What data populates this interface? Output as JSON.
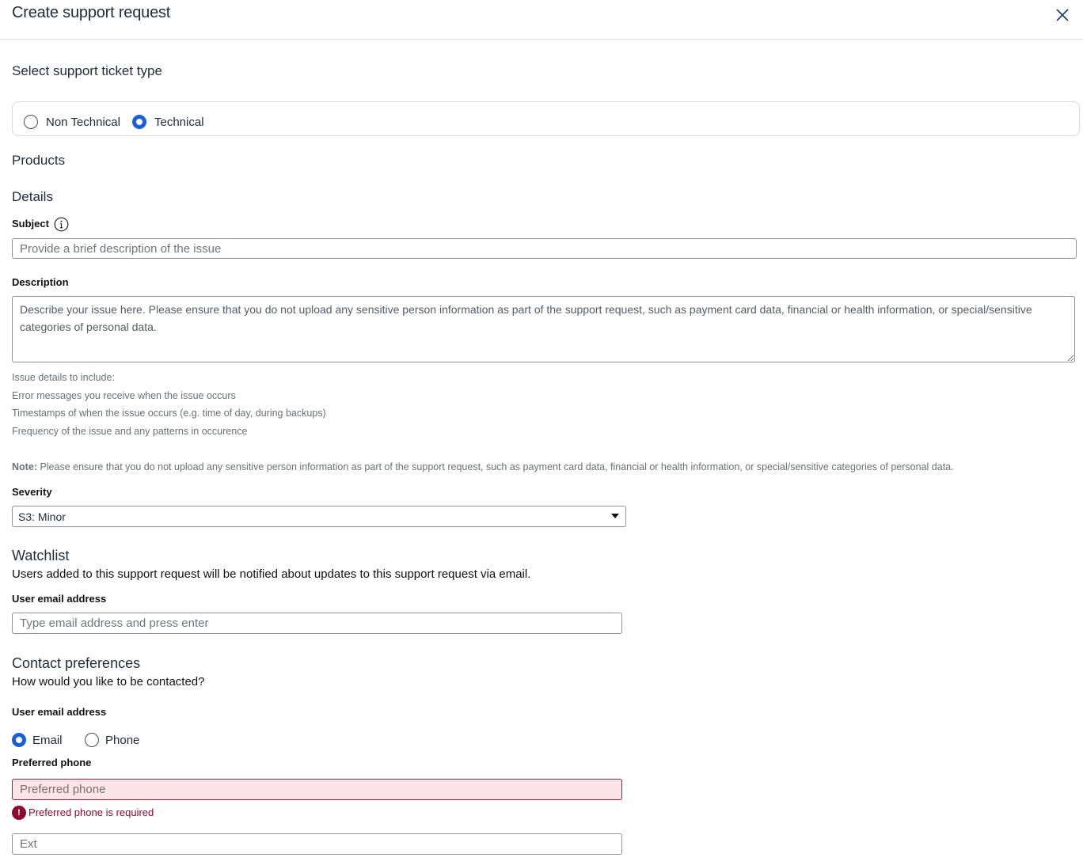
{
  "header": {
    "title": "Create support request"
  },
  "ticket_type": {
    "title": "Select support ticket type",
    "options": [
      {
        "label": "Non Technical",
        "selected": false
      },
      {
        "label": "Technical",
        "selected": true
      }
    ]
  },
  "products": {
    "title": "Products"
  },
  "details": {
    "title": "Details",
    "subject": {
      "label": "Subject",
      "placeholder": "Provide a brief description of the issue",
      "value": ""
    },
    "description": {
      "label": "Description",
      "placeholder": "Describe your issue here. Please ensure that you do not upload any sensitive person information as part of the support request, such as payment card data, financial or health information, or special/sensitive categories of personal data.",
      "value": ""
    },
    "hints": [
      "Issue details to include:",
      "Error messages you receive when the issue occurs",
      "Timestamps of when the issue occurs (e.g. time of day, during backups)",
      "Frequency of the issue and any patterns in occurence"
    ],
    "note_label": "Note:",
    "note_text": "Please ensure that you do not upload any sensitive person information as part of the support request, such as payment card data, financial or health information, or special/sensitive categories of personal data.",
    "severity": {
      "label": "Severity",
      "value": "S3: Minor"
    }
  },
  "watchlist": {
    "title": "Watchlist",
    "description": "Users added to this support request will be notified about updates to this support request via email.",
    "email_label": "User email address",
    "email_placeholder": "Type email address and press enter"
  },
  "contact": {
    "title": "Contact preferences",
    "question": "How would you like to be contacted?",
    "email_label": "User email address",
    "options": [
      {
        "label": "Email",
        "selected": true
      },
      {
        "label": "Phone",
        "selected": false
      }
    ],
    "phone_label": "Preferred phone",
    "phone_placeholder": "Preferred phone",
    "phone_error": "Preferred phone is required",
    "error_icon_glyph": "!",
    "ext_placeholder": "Ext"
  },
  "colors": {
    "accent": "#1b5fd9",
    "error": "#8a0c2e",
    "error_bg": "#fde4e6"
  }
}
